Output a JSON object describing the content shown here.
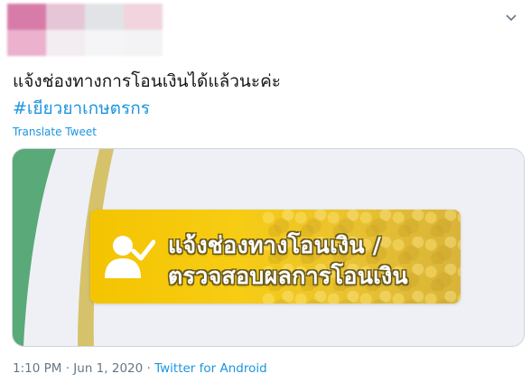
{
  "header": {
    "avatar_colors": [
      "#d77ca8",
      "#e6c6d6",
      "#e2e3e6",
      "#f1d4de",
      "#ebb1cd",
      "#f3ecf0",
      "#f5f5f7",
      "#f3f3f5"
    ],
    "menu_icon": "chevron-down-icon"
  },
  "tweet": {
    "text": "แจ้งช่องทางการโอนเงินได้แล้วนะค่ะ",
    "hashtag": "#เยียวยาเกษตรกร",
    "translate_label": "Translate Tweet"
  },
  "media": {
    "banner_line1": "แจ้งช่องทางโอนเงิน /",
    "banner_line2": "ตรวจสอบผลการโอนเงิน",
    "banner_icon": "user-check-icon",
    "colors": {
      "banner": "#f4c400",
      "green_arc": "#5aa978",
      "gold_arc": "#d6c26a",
      "card_bg": "#eef0f5"
    }
  },
  "meta": {
    "time": "1:10 PM",
    "separator": "·",
    "date": "Jun 1, 2020",
    "source": "Twitter for Android"
  }
}
